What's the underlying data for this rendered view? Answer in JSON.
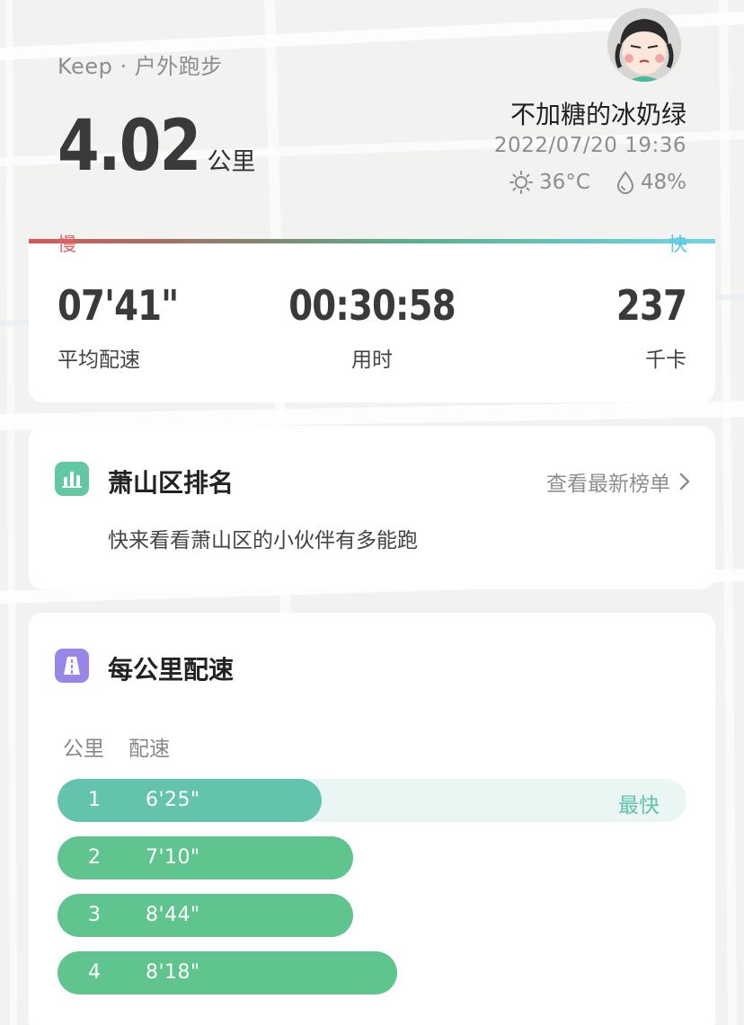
{
  "header": {
    "source": "Keep · 户外跑步",
    "distance_value": "4.02",
    "distance_unit": "公里",
    "username": "不加糖的冰奶绿",
    "datetime": "2022/07/20 19:36",
    "temperature": "36°C",
    "humidity": "48%"
  },
  "pace_scale": {
    "slow": "慢",
    "fast": "快"
  },
  "stats": {
    "avg_pace_value": "07'41\"",
    "avg_pace_label": "平均配速",
    "duration_value": "00:30:58",
    "duration_label": "用时",
    "calories_value": "237",
    "calories_label": "千卡"
  },
  "ranking": {
    "title": "萧山区排名",
    "link": "查看最新榜单",
    "description": "快来看看萧山区的小伙伴有多能跑"
  },
  "pace_per_km": {
    "title": "每公里配速",
    "col_km": "公里",
    "col_pace": "配速",
    "fastest_badge": "最快",
    "rows": [
      {
        "km": "1",
        "pace": "6'25\"",
        "level": 0.42,
        "fastest": true
      },
      {
        "km": "2",
        "pace": "7'10\"",
        "level": 0.47,
        "fastest": false
      },
      {
        "km": "3",
        "pace": "8'44\"",
        "level": 0.47,
        "fastest": false
      },
      {
        "km": "4",
        "pace": "8'18\"",
        "level": 0.54,
        "fastest": false
      }
    ]
  },
  "colors": {
    "accent_green": "#5fc48e",
    "teal": "#63c3ad",
    "slow_red": "#e46565",
    "fast_blue": "#58c6e6",
    "purple": "#9a86e6"
  }
}
